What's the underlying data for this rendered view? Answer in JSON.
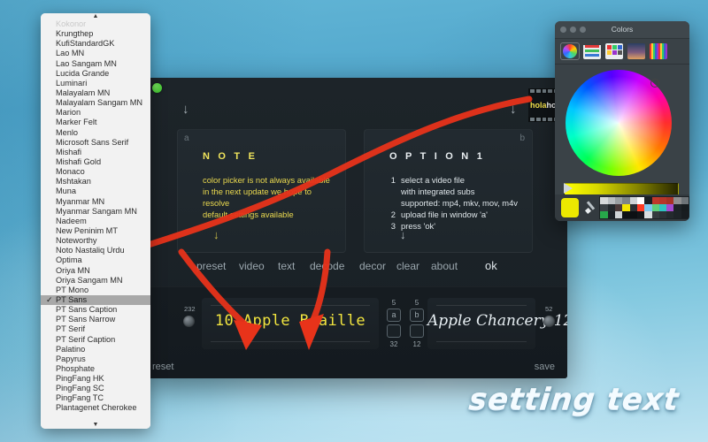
{
  "app": {
    "window_title": "",
    "arrows": [
      "↓",
      "↓"
    ],
    "panels": [
      {
        "tag": "a",
        "title": "N O T E",
        "lines": [
          "color picker is not always available",
          "in the next update we hope to resolve",
          "default settings available"
        ],
        "down_arrow": "↓"
      },
      {
        "tag": "b",
        "title": "O P T I O N  1",
        "items": [
          {
            "n": "1",
            "text": "select a video file",
            "subs": [
              "with integrated subs",
              "supported: mp4, mkv, mov, m4v"
            ]
          },
          {
            "n": "2",
            "text": "upload file in window 'a'",
            "subs": []
          },
          {
            "n": "3",
            "text": "press 'ok'",
            "subs": []
          }
        ],
        "down_arrow": "↓"
      }
    ],
    "filmstrip": {
      "text_yellow": "hola",
      "text_white": "hola"
    },
    "toolbar": [
      {
        "label": "preset"
      },
      {
        "label": "video"
      },
      {
        "label": "text"
      },
      {
        "label": "decode"
      },
      {
        "label": "decor"
      },
      {
        "label": "clear"
      },
      {
        "label": "about"
      },
      {
        "label": "ok"
      }
    ],
    "editor": {
      "left_knob_value": "232",
      "right_knob_value": "52",
      "sample_a": "10 Apple Braille",
      "sample_b": "Apple Chancery 12",
      "stepper_a": {
        "top": "5",
        "letter": "a",
        "bottom": "32"
      },
      "stepper_b": {
        "top": "5",
        "letter": "b",
        "bottom": "12"
      }
    },
    "footer": {
      "reset_label": "reset",
      "save_label": "save"
    }
  },
  "font_menu": {
    "scroll_up_glyph": "▲",
    "scroll_down_glyph": "▼",
    "check_glyph": "✓",
    "selected": "PT Sans",
    "items": [
      "Kokonor",
      "Krungthep",
      "KufiStandardGK",
      "Lao MN",
      "Lao Sangam MN",
      "Lucida Grande",
      "Luminari",
      "Malayalam MN",
      "Malayalam Sangam MN",
      "Marion",
      "Marker Felt",
      "Menlo",
      "Microsoft Sans Serif",
      "Mishafi",
      "Mishafi Gold",
      "Monaco",
      "Mshtakan",
      "Muna",
      "Myanmar MN",
      "Myanmar Sangam MN",
      "Nadeem",
      "New Peninim MT",
      "Noteworthy",
      "Noto Nastaliq Urdu",
      "Optima",
      "Oriya MN",
      "Oriya Sangam MN",
      "PT Mono",
      "PT Sans",
      "PT Sans Caption",
      "PT Sans Narrow",
      "PT Serif",
      "PT Serif Caption",
      "Palatino",
      "Papyrus",
      "Phosphate",
      "PingFang HK",
      "PingFang SC",
      "PingFang TC",
      "Plantagenet Cherokee"
    ]
  },
  "colors_panel": {
    "title": "Colors",
    "tabs": [
      "color-wheel",
      "color-sliders",
      "color-palettes",
      "image-palettes",
      "pencils"
    ],
    "selected_tab": "color-wheel",
    "current_color": "#ece900",
    "brightness_hex_start": "#ffff00",
    "swatches": [
      "#d6d9da",
      "#b9bec1",
      "#9aa0a3",
      "#7d8487",
      "#cfd4d6",
      "#ffffff",
      "#1b1f22",
      "#c0392b",
      "#b7362a",
      "#a83226",
      "#8f8f8f",
      "#6e7478",
      "#3a4145",
      "#22282c",
      "#4a3a3a",
      "#f3e600",
      "#2a2f33",
      "#ff3b24",
      "#7ec8ef",
      "#5fcf7a",
      "#2fc2c2",
      "#a34bd0",
      "#1d2327",
      "#171c1f",
      "#27a84a",
      "#1b2126",
      "#cfd4d6",
      "#0f1316",
      "#0c1013",
      "#121619",
      "#d9dee0",
      "#343a3e",
      "#2b3135",
      "#242a2e",
      "#1e2428",
      "#181d21"
    ]
  },
  "caption": {
    "text": "setting text"
  }
}
